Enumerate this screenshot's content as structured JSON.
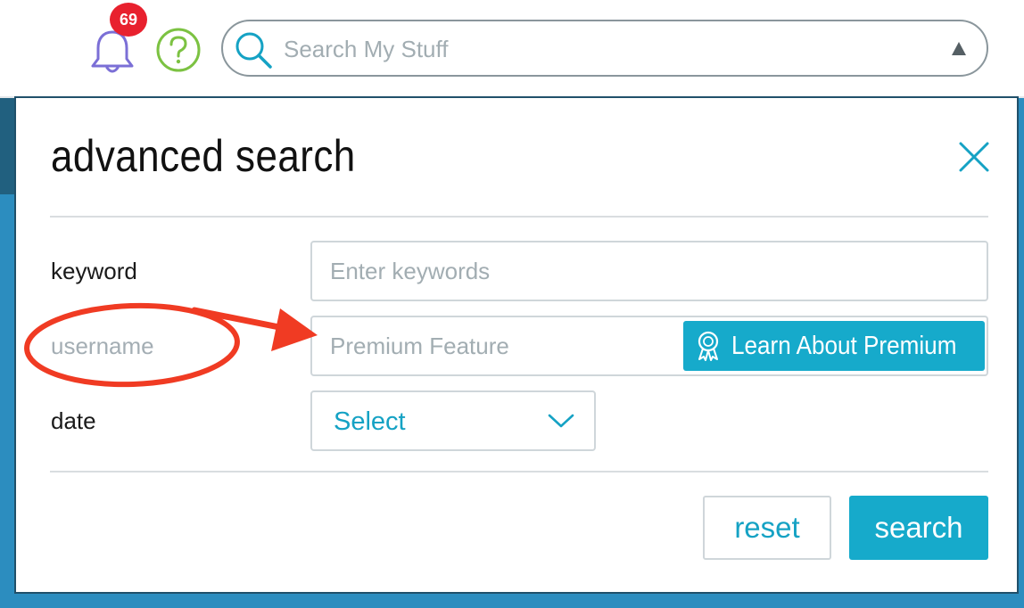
{
  "header": {
    "notifications": {
      "icon": "bell-icon",
      "count": "69",
      "badge_color": "#e8212e",
      "icon_color": "#7b6fd6"
    },
    "help": {
      "icon": "question-mark-circle-icon",
      "color": "#7cc242"
    },
    "search": {
      "icon": "magnifier-icon",
      "placeholder": "Search My Stuff",
      "toggle_icon": "triangle-up-icon"
    }
  },
  "dialog": {
    "title": "advanced search",
    "close_icon": "close-x-icon",
    "fields": {
      "keyword": {
        "label": "keyword",
        "placeholder": "Enter keywords",
        "value": ""
      },
      "username": {
        "label": "username",
        "placeholder": "Premium Feature",
        "disabled": true,
        "premium_button": {
          "icon": "award-ribbon-icon",
          "label": "Learn About Premium"
        }
      },
      "date": {
        "label": "date",
        "selected": "Select",
        "chevron_icon": "chevron-down-icon"
      }
    },
    "actions": {
      "reset_label": "reset",
      "search_label": "search"
    }
  },
  "annotation": {
    "type": "circle-and-arrow",
    "color": "#f03b23",
    "target": "username"
  },
  "colors": {
    "accent": "#16aacb",
    "backdrop": "#2c8dbf"
  }
}
